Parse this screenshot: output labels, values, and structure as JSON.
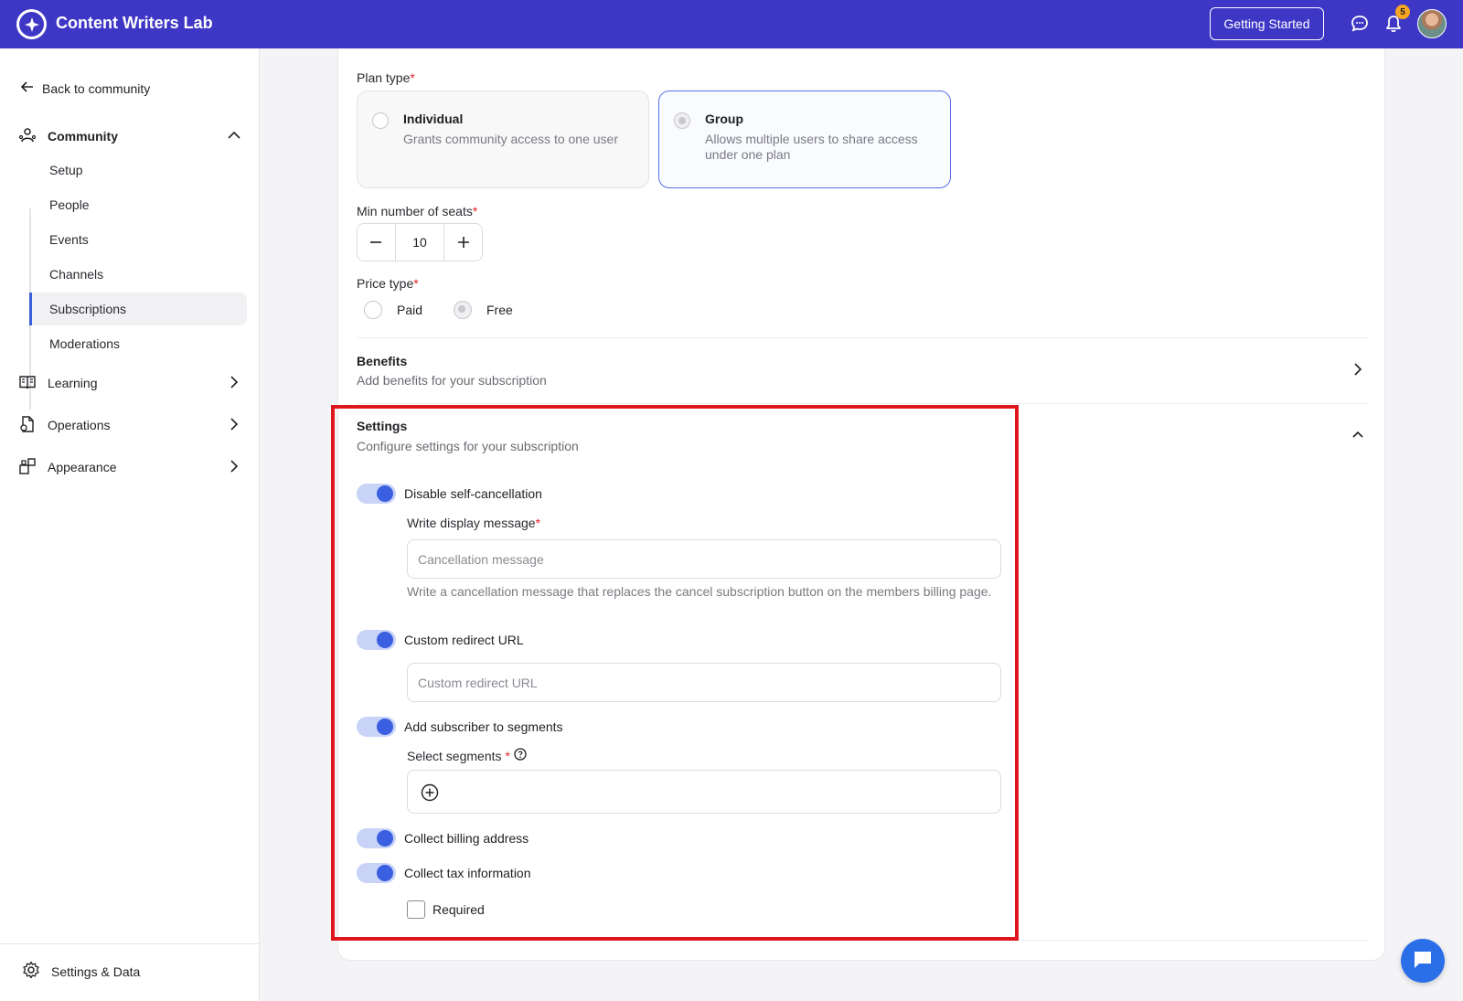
{
  "app": {
    "title": "Content Writers Lab"
  },
  "topbar": {
    "getting_started": "Getting Started",
    "notification_count": "5"
  },
  "sidebar": {
    "back_label": "Back to community",
    "community": {
      "label": "Community",
      "items": [
        "Setup",
        "People",
        "Events",
        "Channels",
        "Subscriptions",
        "Moderations"
      ],
      "active": "Subscriptions"
    },
    "learning": "Learning",
    "operations": "Operations",
    "appearance": "Appearance",
    "footer": "Settings & Data"
  },
  "plan": {
    "label": "Plan type",
    "options": [
      {
        "title": "Individual",
        "desc": "Grants community access to one user",
        "selected": false
      },
      {
        "title": "Group",
        "desc": "Allows multiple users to share access under one plan",
        "selected": true
      }
    ]
  },
  "seats": {
    "label": "Min number of seats",
    "value": "10"
  },
  "price": {
    "label": "Price type",
    "options": [
      "Paid",
      "Free"
    ],
    "selected": "Free"
  },
  "benefits": {
    "title": "Benefits",
    "desc": "Add benefits for your subscription"
  },
  "settings": {
    "title": "Settings",
    "desc": "Configure settings for your subscription",
    "disable_cancel": "Disable self-cancellation",
    "display_msg_label": "Write display message",
    "cancel_placeholder": "Cancellation message",
    "cancel_help": "Write a cancellation message that replaces the cancel subscription button on the members billing page.",
    "redirect_toggle": "Custom redirect URL",
    "redirect_placeholder": "Custom redirect URL",
    "segments_toggle": "Add subscriber to segments",
    "segments_label": "Select segments",
    "billing_toggle": "Collect billing address",
    "tax_toggle": "Collect tax information",
    "required_label": "Required"
  },
  "colors": {
    "brand": "#3e37c5",
    "accent": "#3a5fe0",
    "highlight": "#e0161d"
  }
}
